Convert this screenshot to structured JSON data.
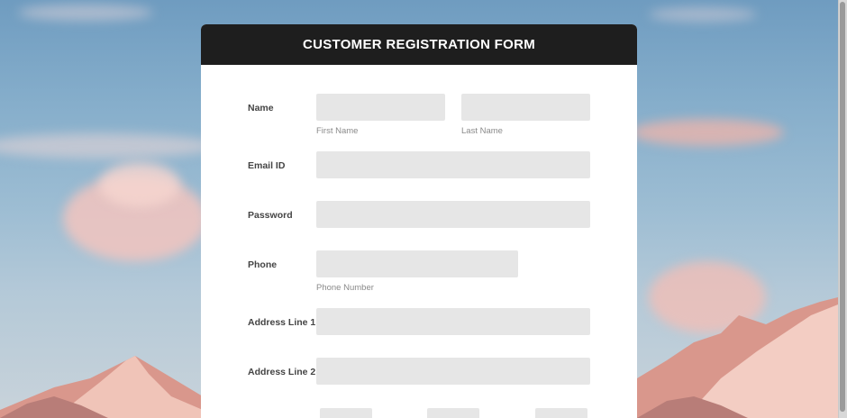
{
  "form": {
    "title": "CUSTOMER REGISTRATION FORM",
    "fields": {
      "name": {
        "label": "Name",
        "first_value": "",
        "first_caption": "First Name",
        "last_value": "",
        "last_caption": "Last Name"
      },
      "email": {
        "label": "Email ID",
        "value": ""
      },
      "password": {
        "label": "Password",
        "value": ""
      },
      "phone": {
        "label": "Phone",
        "value": "",
        "caption": "Phone Number"
      },
      "address1": {
        "label": "Address Line 1",
        "value": ""
      },
      "address2": {
        "label": "Address Line 2",
        "value": ""
      }
    }
  },
  "colors": {
    "header_bg": "#1e1e1e",
    "field_bg": "#e6e6e6",
    "card_bg": "#ffffff"
  },
  "icons": {
    "background": "mountain-landscape-image"
  }
}
